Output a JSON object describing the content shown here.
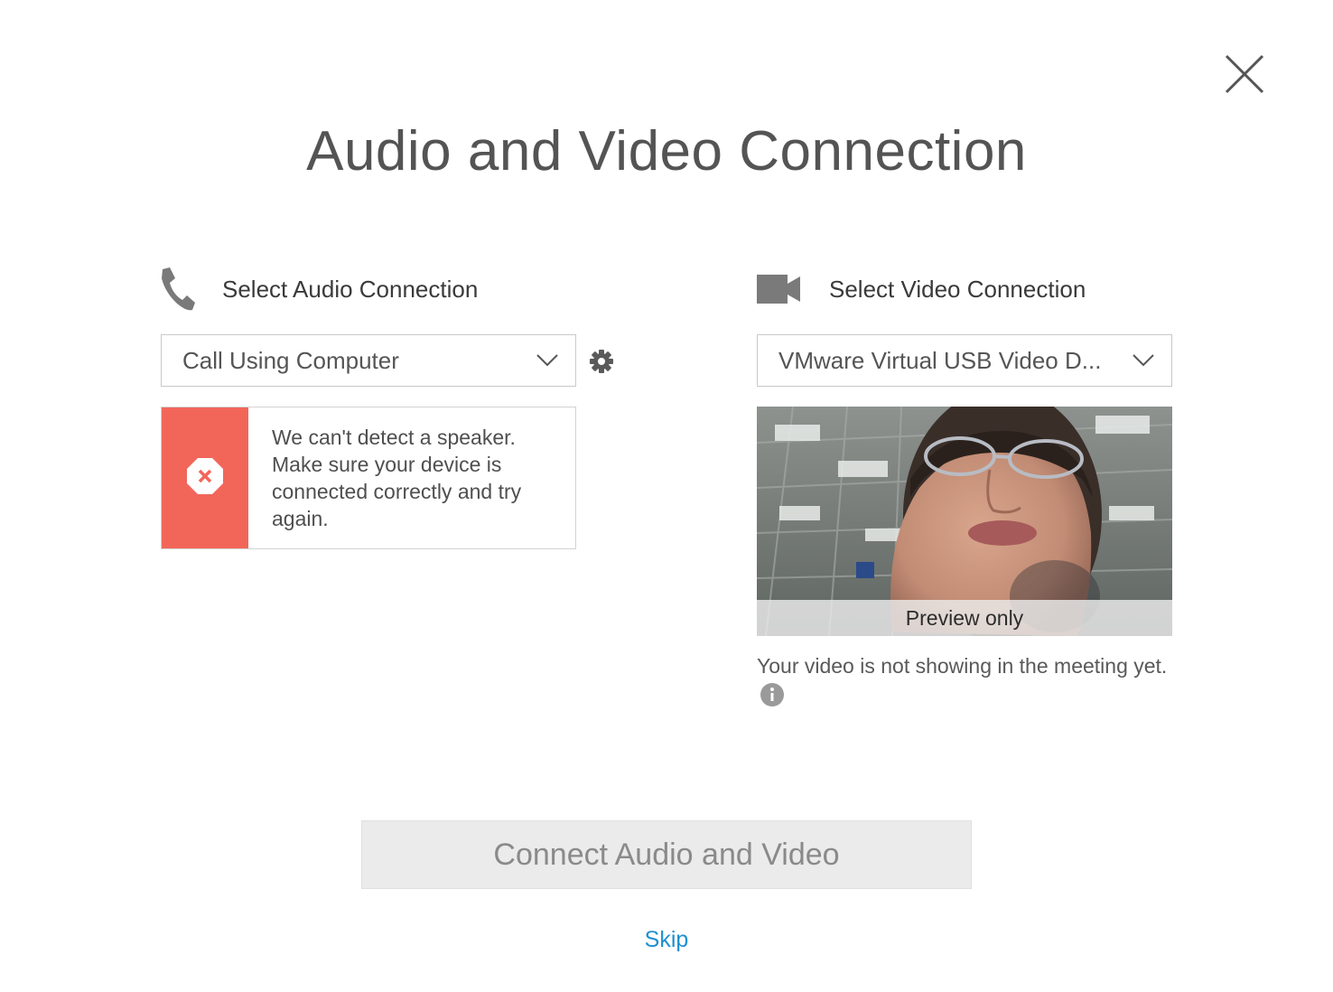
{
  "dialog": {
    "title": "Audio and Video Connection",
    "close_icon": "close-icon"
  },
  "audio": {
    "header_label": "Select Audio Connection",
    "icon": "phone-icon",
    "selected": "Call Using Computer",
    "settings_icon": "gear-icon",
    "error_icon": "error-octagon-icon",
    "error_message": "We can't detect a speaker. Make sure your device is connected correctly and try again.",
    "error_color": "#f2665a"
  },
  "video": {
    "header_label": "Select Video Connection",
    "icon": "video-camera-icon",
    "selected": "VMware Virtual USB Video D...",
    "preview_caption": "Preview only",
    "note": "Your video is not showing in the meeting yet.",
    "info_icon": "info-icon"
  },
  "actions": {
    "connect_label": "Connect Audio and Video",
    "skip_label": "Skip",
    "link_color": "#1f8fd1"
  }
}
